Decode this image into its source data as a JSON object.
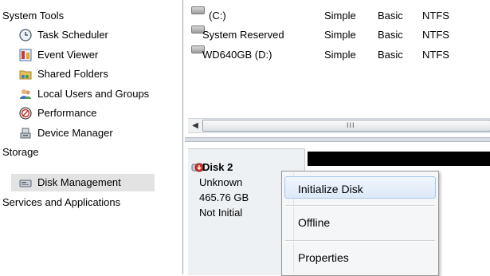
{
  "tree": {
    "system_tools": "System Tools",
    "task_scheduler": "Task Scheduler",
    "event_viewer": "Event Viewer",
    "shared_folders": "Shared Folders",
    "local_users": "Local Users and Groups",
    "performance": "Performance",
    "device_manager": "Device Manager",
    "storage": "Storage",
    "disk_management": "Disk Management",
    "services": "Services and Applications"
  },
  "volumes": [
    {
      "name": "(C:)",
      "layout": "Simple",
      "type": "Basic",
      "fs": "NTFS"
    },
    {
      "name": "System Reserved",
      "layout": "Simple",
      "type": "Basic",
      "fs": "NTFS"
    },
    {
      "name": "WD640GB (D:)",
      "layout": "Simple",
      "type": "Basic",
      "fs": "NTFS"
    }
  ],
  "scroll": {
    "grip": "III",
    "left_arrow": "◀"
  },
  "disk": {
    "name": "Disk 2",
    "status1": "Unknown",
    "size": "465.76 GB",
    "status2": "Not Initial"
  },
  "menu": {
    "initialize": "Initialize Disk",
    "offline": "Offline",
    "properties": "Properties"
  },
  "colors": {
    "menu_hover_border": "#a8c8ea",
    "menu_bg": "#f5f6f7"
  }
}
